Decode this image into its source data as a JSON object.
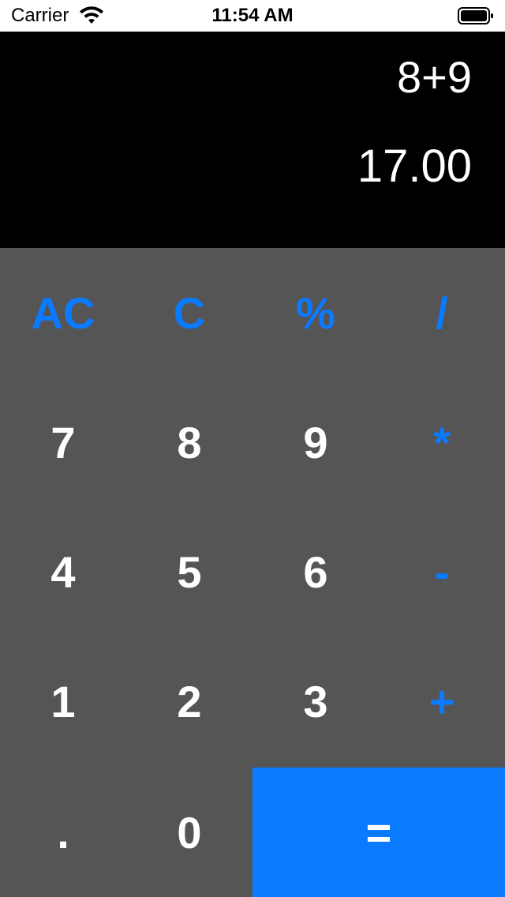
{
  "status_bar": {
    "carrier": "Carrier",
    "time": "11:54 AM",
    "wifi_icon": "wifi-icon",
    "battery_icon": "battery-icon"
  },
  "display": {
    "expression": "8+9",
    "result": "17.00"
  },
  "keypad": {
    "row1": [
      "AC",
      "C",
      "%",
      "/"
    ],
    "row2": [
      "7",
      "8",
      "9",
      "*"
    ],
    "row3": [
      "4",
      "5",
      "6",
      "-"
    ],
    "row4": [
      "1",
      "2",
      "3",
      "+"
    ],
    "row5": [
      ".",
      "0",
      "="
    ]
  },
  "colors": {
    "accent": "#0a7aff",
    "keypad_bg": "#555555",
    "display_bg": "#000000",
    "digit_text": "#ffffff"
  }
}
